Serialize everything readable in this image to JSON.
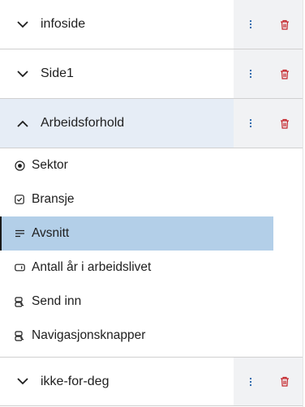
{
  "pages": [
    {
      "title": "infoside",
      "expanded": false
    },
    {
      "title": "Side1",
      "expanded": false
    },
    {
      "title": "Arbeidsforhold",
      "expanded": true
    },
    {
      "title": "ikke-for-deg",
      "expanded": false
    }
  ],
  "components": [
    {
      "label": "Sektor",
      "icon": "radio-icon"
    },
    {
      "label": "Bransje",
      "icon": "checkbox-icon"
    },
    {
      "label": "Avsnitt",
      "icon": "paragraph-icon",
      "selected": true
    },
    {
      "label": "Antall år i arbeidslivet",
      "icon": "input-icon"
    },
    {
      "label": "Send inn",
      "icon": "button-icon"
    },
    {
      "label": "Navigasjonsknapper",
      "icon": "button-icon"
    }
  ],
  "colors": {
    "accent_selected": "#b3cfe8",
    "delete": "#c4242a",
    "menu": "#1f5fa8",
    "active_header": "#e6edf6"
  }
}
